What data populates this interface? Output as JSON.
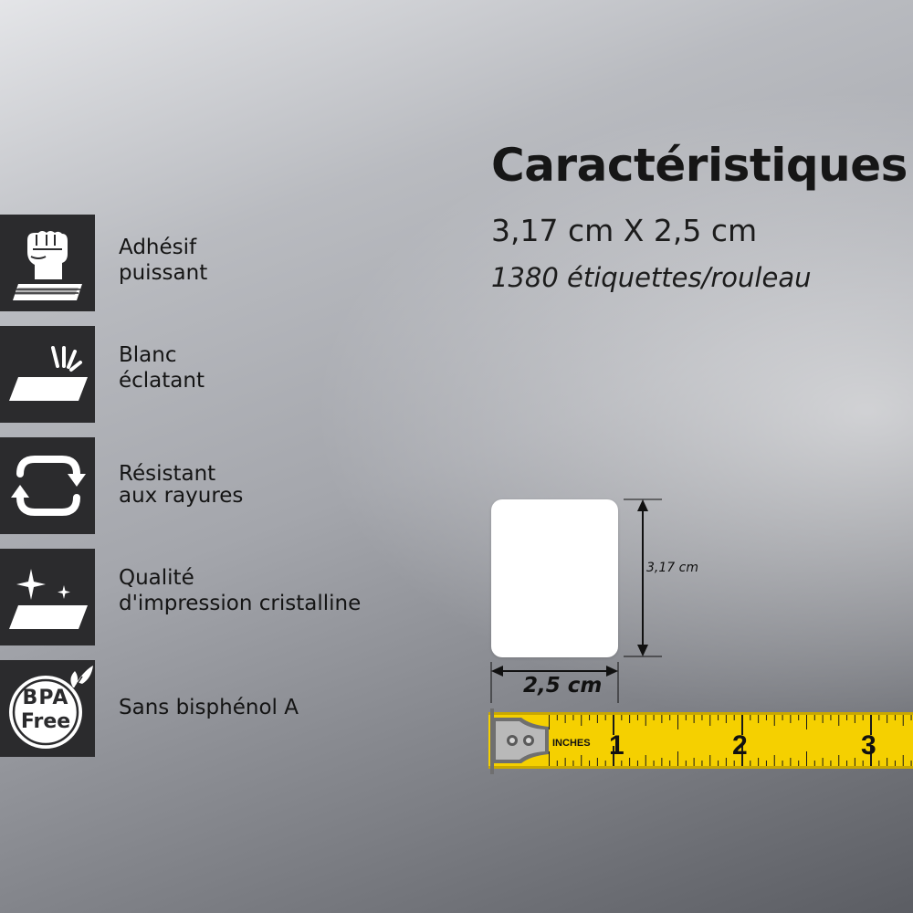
{
  "header": {
    "title": "Caractéristiques",
    "dimensions": "3,17 cm X 2,5 cm",
    "count": "1380 étiquettes/rouleau"
  },
  "features": [
    {
      "icon": "fist-icon",
      "label": "Adhésif\npuissant"
    },
    {
      "icon": "bright-label-icon",
      "label": "Blanc\néclatant"
    },
    {
      "icon": "refresh-arrows-icon",
      "label": "Résistant\naux rayures"
    },
    {
      "icon": "sparkle-label-icon",
      "label": "Qualité\nd'impression cristalline"
    },
    {
      "icon": "bpa-free-icon",
      "label": "Sans bisphénol A",
      "badge_top": "BPA",
      "badge_bottom": "Free"
    }
  ],
  "diagram": {
    "width_label": "2,5 cm",
    "height_label": "3,17 cm"
  },
  "tape": {
    "unit_label": "INCHES",
    "numbers": [
      "1",
      "2",
      "3"
    ],
    "color": "#f5d000"
  },
  "colors": {
    "icon_background": "#2b2b2d",
    "text": "#141414"
  }
}
